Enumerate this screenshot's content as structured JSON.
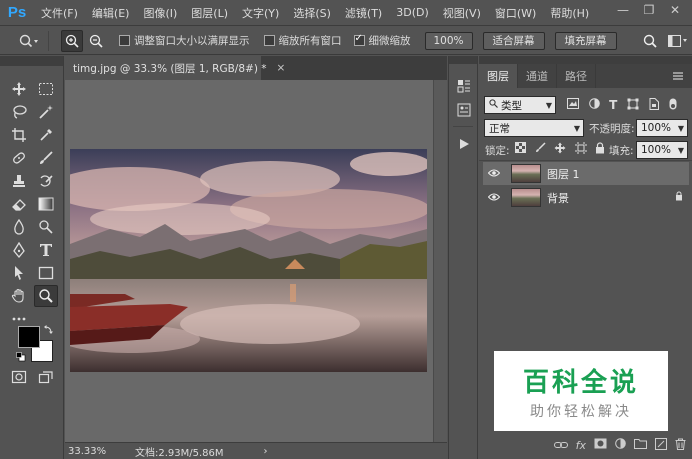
{
  "app": {
    "logo": "Ps"
  },
  "menu": [
    "文件(F)",
    "编辑(E)",
    "图像(I)",
    "图层(L)",
    "文字(Y)",
    "选择(S)",
    "滤镜(T)",
    "3D(D)",
    "视图(V)",
    "窗口(W)",
    "帮助(H)"
  ],
  "window_controls": {
    "minimize": "—",
    "restore": "❐",
    "close": "✕"
  },
  "options": {
    "resize_windows": "调整窗口大小以满屏显示",
    "zoom_all_windows": "缩放所有窗口",
    "scrubby_zoom": "细微缩放",
    "zoom_value": "100%",
    "fit_screen": "适合屏幕",
    "fill_screen": "填充屏幕",
    "resize_windows_checked": false,
    "zoom_all_checked": false,
    "scrubby_checked": true
  },
  "document": {
    "tab_title": "timg.jpg @ 33.3% (图层 1, RGB/8#) *",
    "close": "×",
    "zoom": "33.33%",
    "doc_info": "文档:2.93M/5.86M",
    "status_arrow": "›"
  },
  "panel": {
    "tabs": [
      "图层",
      "通道",
      "路径"
    ],
    "filter_kind": "类型",
    "blend_mode": "正常",
    "opacity_label": "不透明度:",
    "opacity_value": "100%",
    "lock_label": "锁定:",
    "fill_label": "填充:",
    "fill_value": "100%",
    "layers": [
      {
        "name": "图层 1",
        "selected": true,
        "locked": false
      },
      {
        "name": "背景",
        "selected": false,
        "locked": true
      }
    ]
  },
  "watermark": {
    "line1": "百科全说",
    "line2": "助你轻松解决"
  }
}
